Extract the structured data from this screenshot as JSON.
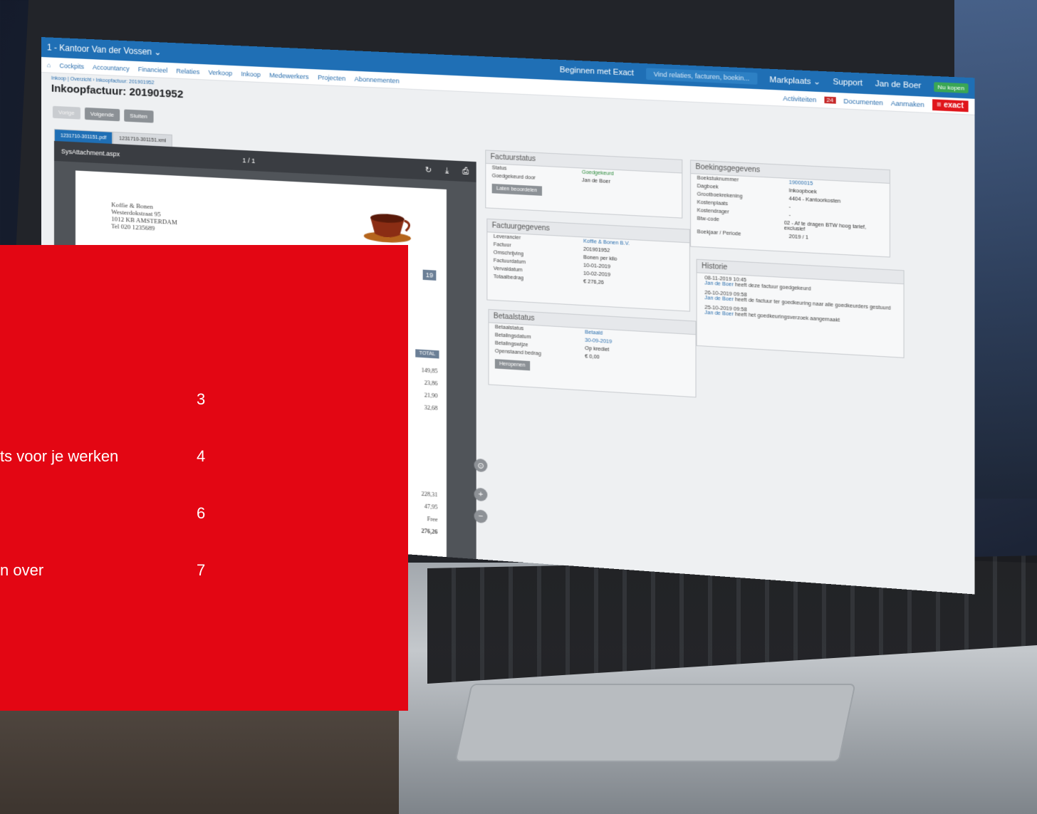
{
  "app": {
    "window_title": "1 - Kantoor Van der Vossen ⌄",
    "top_links": [
      "Beginnen met Exact",
      "Markplaats ⌄",
      "Support",
      "Jan de Boer"
    ],
    "search_placeholder": "Vind relaties, facturen, boekin...",
    "status_badge": "Nu kopen",
    "nav": [
      "Cockpits",
      "Accountancy",
      "Financieel",
      "Relaties",
      "Verkoop",
      "Inkoop",
      "Medewerkers",
      "Projecten",
      "Abonnementen"
    ],
    "nav_right": {
      "activities": "Activiteiten",
      "activities_count": "24",
      "documents": "Documenten",
      "create": "Aanmaken",
      "logo": "≡ exact"
    },
    "breadcrumb": "Inkoop | Overzicht › Inkoopfactuur: 201901952",
    "page_title": "Inkoopfactuur: 201901952",
    "buttons": {
      "prev": "Vorige",
      "next": "Volgende",
      "close": "Sluiten"
    },
    "tabs": [
      "1231710-301151.pdf",
      "1231710-301151.xml"
    ],
    "viewer": {
      "filename": "SysAttachment.aspx",
      "page": "1 / 1",
      "address": [
        "Koffie & Bonen",
        "Westerdokstraat 95",
        "1012 KB AMSTERDAM",
        "Tel 020 1235689"
      ],
      "right_values": [
        "19",
        "TOTAL",
        "149,85",
        "23,86",
        "21,90",
        "32,68",
        "228,31",
        "47,95",
        "Free",
        "276,26"
      ]
    },
    "factuurstatus": {
      "title": "Factuurstatus",
      "rows": [
        {
          "k": "Status",
          "v": "Goedgekeurd"
        },
        {
          "k": "Goedgekeurd door",
          "v": "Jan de Boer"
        }
      ],
      "button": "Laten beoordelen"
    },
    "factuurgegevens": {
      "title": "Factuurgegevens",
      "rows": [
        {
          "k": "Leverancier",
          "v": "Koffie & Bonen B.V."
        },
        {
          "k": "Factuur",
          "v": "201901952"
        },
        {
          "k": "Omschrijving",
          "v": "Bonen per kilo"
        },
        {
          "k": "Factuurdatum",
          "v": "10-01-2019"
        },
        {
          "k": "Vervaldatum",
          "v": "10-02-2019"
        },
        {
          "k": "Totaalbedrag",
          "v": "€ 276,26"
        }
      ]
    },
    "betaalstatus": {
      "title": "Betaalstatus",
      "rows": [
        {
          "k": "Betaalstatus",
          "v": "Betaald"
        },
        {
          "k": "Betalingsdatum",
          "v": "30-09-2019"
        },
        {
          "k": "Betalingswijze",
          "v": "Op krediet"
        },
        {
          "k": "Openstaand bedrag",
          "v": "€ 0,00"
        }
      ],
      "button": "Heropenen"
    },
    "boekingsgegevens": {
      "title": "Boekingsgegevens",
      "rows": [
        {
          "k": "Boekstuknummer",
          "v": "19000015"
        },
        {
          "k": "Dagboek",
          "v": "Inkoopboek"
        },
        {
          "k": "Grootboekrekening",
          "v": "4404 - Kantoorkosten"
        },
        {
          "k": "Kostenplaats",
          "v": "-"
        },
        {
          "k": "Kostendrager",
          "v": "-"
        },
        {
          "k": "Btw-code",
          "v": "02 - Af te dragen BTW hoog tarief, exclusief"
        },
        {
          "k": "Boekjaar / Periode",
          "v": "2019 / 1"
        }
      ]
    },
    "historie": {
      "title": "Historie",
      "entries": [
        {
          "date": "08-11-2019 10:45",
          "who": "Jan de Boer",
          "text": " heeft deze factuur goedgekeurd"
        },
        {
          "date": "26-10-2019 09:58",
          "who": "Jan de Boer",
          "text": " heeft de factuur ter goedkeuring naar alle goedkeurders gestuurd"
        },
        {
          "date": "25-10-2019 09:58",
          "who": "Jan de Boer",
          "text": " heeft het goedkeuringsverzoek aangemaakt"
        }
      ]
    }
  },
  "toc": [
    {
      "label": "",
      "page": "3"
    },
    {
      "label": "ts voor je werken",
      "page": "4"
    },
    {
      "label": "",
      "page": "6"
    },
    {
      "label": "n over",
      "page": "7"
    }
  ]
}
